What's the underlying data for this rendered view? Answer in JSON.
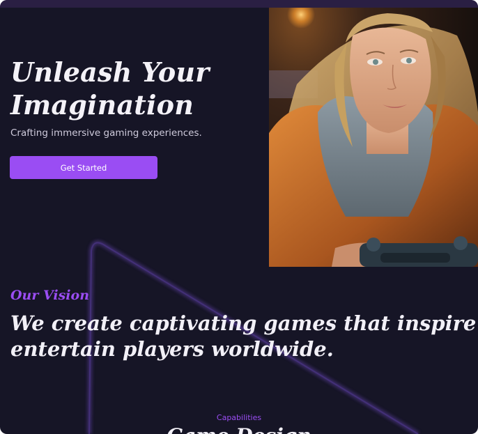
{
  "hero": {
    "title": "Unleash Your Imagination",
    "subtitle": "Crafting immersive gaming experiences.",
    "cta_label": "Get Started",
    "image_alt": "Young woman with long wavy hair holding a game controller"
  },
  "vision": {
    "eyebrow": "Our Vision",
    "statement_line1": "We create captivating games that inspire and",
    "statement_line2": "entertain players worldwide."
  },
  "capabilities": {
    "eyebrow": "Capabilities",
    "title": "Game Design"
  },
  "colors": {
    "background": "#161526",
    "accent": "#9a4df3",
    "heading": "#f4f2f8",
    "body_text": "#cfcbdc"
  }
}
